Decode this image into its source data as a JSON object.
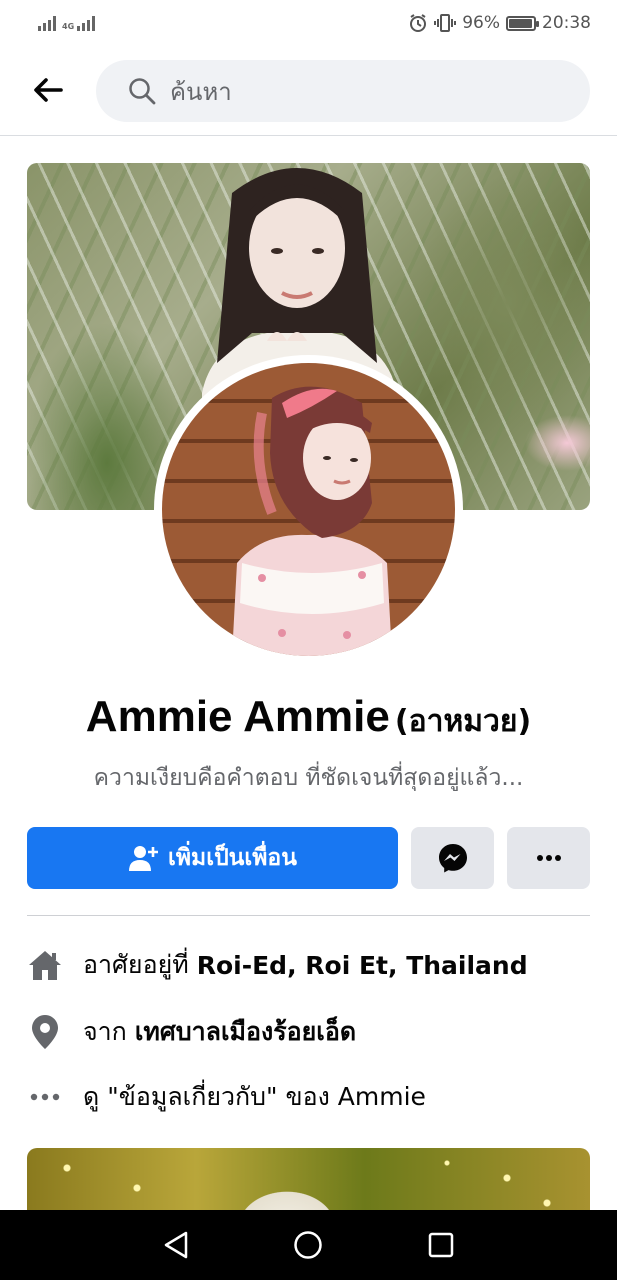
{
  "status_bar": {
    "network": "4G",
    "battery_percent": "96%",
    "battery_level": 0.96,
    "time": "20:38",
    "icons": [
      "signal-icon",
      "alarm-icon",
      "vibrate-icon",
      "battery-icon"
    ]
  },
  "header": {
    "back_icon": "arrow-left-icon",
    "search": {
      "placeholder": "ค้นหา",
      "icon": "search-icon"
    }
  },
  "profile": {
    "name": "Ammie Ammie",
    "alternate_name": "(อาหมวย)",
    "bio": "ความเงียบคือคำตอบ ที่ชัดเจนที่สุดอยู่แล้ว..."
  },
  "actions": {
    "add_friend_label": "เพิ่มเป็นเพื่อน",
    "add_friend_icon": "add-person-icon",
    "messenger_icon": "messenger-icon",
    "more_icon": "more-dots-icon"
  },
  "intro": {
    "lives_in_prefix": "อาศัยอยู่ที่",
    "lives_in_value": "Roi-Ed, Roi Et, Thailand",
    "from_prefix": "จาก",
    "from_value": "เทศบาลเมืองร้อยเอ็ด",
    "about_prefix": "ดู",
    "about_value": "\"ข้อมูลเกี่ยวกับ\"",
    "about_suffix": "ของ Ammie"
  },
  "colors": {
    "primary": "#1877f2",
    "secondary_button": "#e4e6eb",
    "text_primary": "#050505",
    "text_secondary": "#65676b"
  },
  "nav": {
    "back": "triangle-back-icon",
    "home": "circle-home-icon",
    "recents": "square-recents-icon"
  }
}
